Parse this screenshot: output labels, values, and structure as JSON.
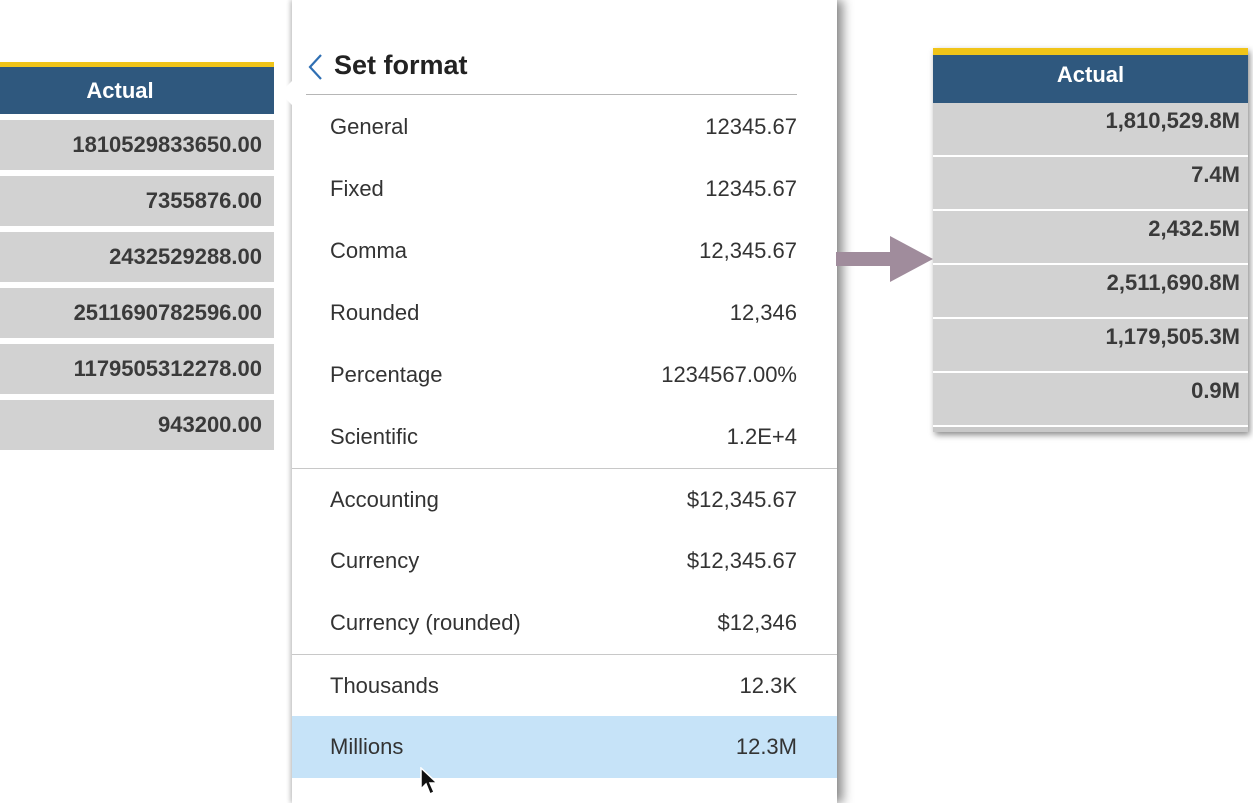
{
  "left_table": {
    "header": "Actual",
    "values": [
      "1810529833650.00",
      "7355876.00",
      "2432529288.00",
      "2511690782596.00",
      "1179505312278.00",
      "943200.00"
    ]
  },
  "popup": {
    "title": "Set format",
    "formats": [
      {
        "name": "General",
        "example": "12345.67"
      },
      {
        "name": "Fixed",
        "example": "12345.67"
      },
      {
        "name": "Comma",
        "example": "12,345.67"
      },
      {
        "name": "Rounded",
        "example": "12,346"
      },
      {
        "name": "Percentage",
        "example": "1234567.00%"
      },
      {
        "name": "Scientific",
        "example": "1.2E+4"
      },
      {
        "name": "Accounting",
        "example": "$12,345.67"
      },
      {
        "name": "Currency",
        "example": "$12,345.67"
      },
      {
        "name": "Currency (rounded)",
        "example": "$12,346"
      },
      {
        "name": "Thousands",
        "example": "12.3K"
      },
      {
        "name": "Millions",
        "example": "12.3M"
      }
    ],
    "selected": "Millions"
  },
  "right_table": {
    "header": "Actual",
    "values": [
      "1,810,529.8M",
      "7.4M",
      "2,432.5M",
      "2,511,690.8M",
      "1,179,505.3M",
      "0.9M"
    ]
  },
  "colors": {
    "header_bg": "#2f587e",
    "header_accent": "#f0c419",
    "cell_bg": "#d2d2d2",
    "selected_row": "#c6e3f8",
    "arrow": "#a08c9c"
  },
  "icons": [
    "chevron-left-icon",
    "mouse-pointer-icon",
    "right-arrow-icon"
  ]
}
